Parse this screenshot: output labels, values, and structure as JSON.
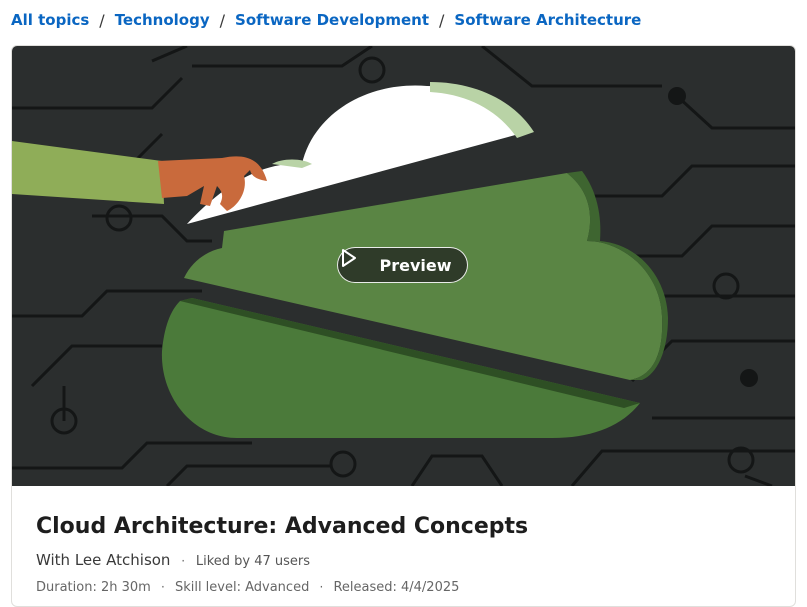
{
  "breadcrumb": {
    "items": [
      "All topics",
      "Technology",
      "Software Development",
      "Software Architecture"
    ],
    "separator": "/"
  },
  "hero": {
    "preview_label": "Preview",
    "icons": {
      "preview": "play-icon"
    },
    "colors": {
      "background": "#2b2e2e",
      "circuit": "#121414",
      "cloud_green": "#5a8544",
      "cloud_dark": "#3e6530",
      "cloud_white": "#ffffff",
      "cloud_pale": "#b9d3a6",
      "sleeve": "#8fad58",
      "hand": "#c96a3c"
    }
  },
  "course": {
    "title": "Cloud Architecture: Advanced Concepts",
    "author_label": "With Lee Atchison",
    "likes_label": "Liked by 47 users",
    "duration_label": "Duration: 2h 30m",
    "skill_label": "Skill level: Advanced",
    "released_label": "Released: 4/4/2025",
    "dot": "·"
  },
  "colors": {
    "link": "#0a66c2",
    "text": "#1d1d1d"
  }
}
